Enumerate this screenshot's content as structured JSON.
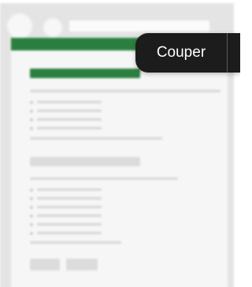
{
  "context_menu": {
    "cut_label": "Couper"
  },
  "colors": {
    "accent_green": "#2a7f3f",
    "tooltip_bg": "#1c1c1c",
    "tooltip_text": "#ffffff"
  }
}
